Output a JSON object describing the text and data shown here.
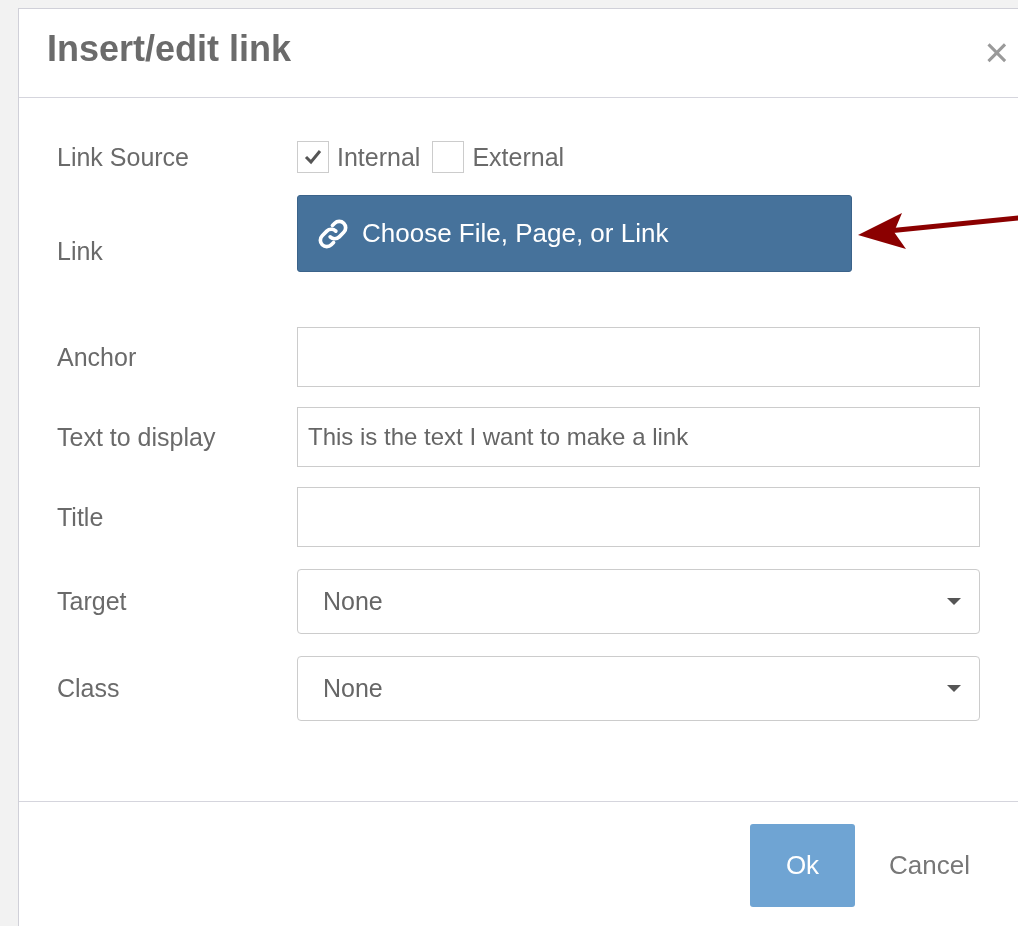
{
  "dialog": {
    "title": "Insert/edit link",
    "close": "×"
  },
  "fields": [
    {
      "kind": "source",
      "label": "Link Source",
      "options": [
        {
          "label": "Internal",
          "checked": true
        },
        {
          "label": "External",
          "checked": false
        }
      ]
    },
    {
      "kind": "button",
      "label": "Link",
      "button": "Choose File, Page, or Link"
    },
    {
      "kind": "text",
      "label": "Anchor"
    },
    {
      "kind": "text",
      "label": "Text to display",
      "value": "This is the text I want to make a link"
    },
    {
      "kind": "text",
      "label": "Title"
    },
    {
      "kind": "select",
      "label": "Target",
      "value": "None"
    },
    {
      "kind": "select",
      "label": "Class",
      "value": "None"
    }
  ],
  "footer": {
    "buttons": [
      {
        "label": "Ok",
        "kind": "primary"
      },
      {
        "label": "Cancel",
        "kind": "plain"
      }
    ]
  }
}
